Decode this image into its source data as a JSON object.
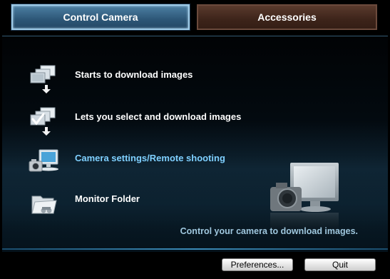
{
  "tabs": [
    {
      "label": "Control Camera"
    },
    {
      "label": "Accessories"
    }
  ],
  "menu": [
    {
      "label": "Starts to download images",
      "icon": "download-images-icon"
    },
    {
      "label": "Lets you select and download images",
      "icon": "select-download-icon"
    },
    {
      "label": "Camera settings/Remote shooting",
      "icon": "remote-shooting-icon"
    },
    {
      "label": "Monitor Folder",
      "icon": "monitor-folder-icon"
    }
  ],
  "tagline": "Control your camera to download images.",
  "buttons": {
    "preferences": "Preferences...",
    "quit": "Quit"
  },
  "colors": {
    "active_tab": "#2d5777",
    "inactive_tab": "#3d241a",
    "highlight_text": "#7fd0ff",
    "tagline_text": "#9fc7de"
  }
}
